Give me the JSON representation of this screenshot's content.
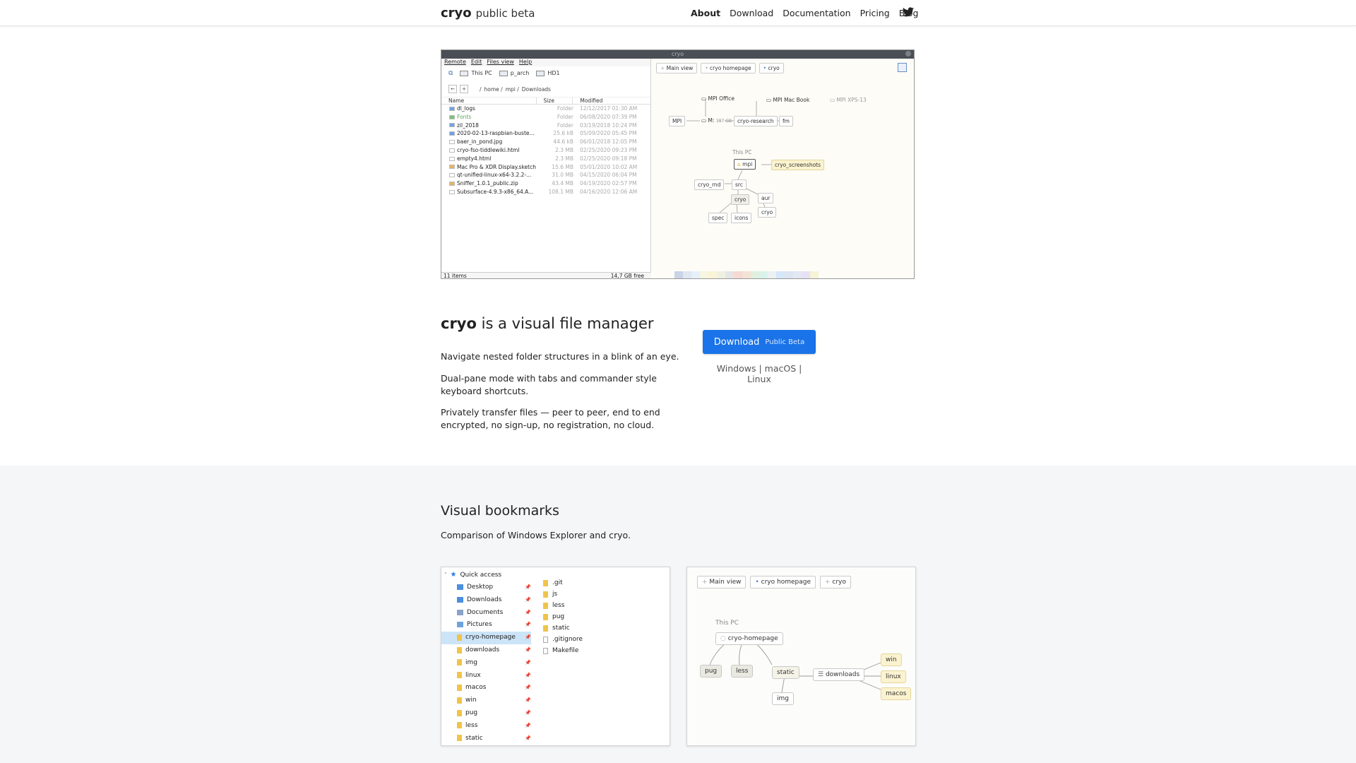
{
  "nav": {
    "brand": "cryo",
    "brand_sub": "public beta",
    "links": [
      "About",
      "Download",
      "Documentation",
      "Pricing",
      "Blog"
    ]
  },
  "hero_shot": {
    "window_title": "cryo",
    "menu": [
      "Remote",
      "Edit",
      "Files view",
      "Help"
    ],
    "drives": [
      "This PC",
      "p_arch",
      "HD1"
    ],
    "path": [
      "/",
      "home /",
      "mpi /",
      "Downloads"
    ],
    "columns": [
      "Name",
      "Size",
      "Modified"
    ],
    "files": [
      {
        "name": "dl_logs",
        "size": "Folder",
        "date": "12/12/2017",
        "time": "01:30 AM",
        "kind": "folder"
      },
      {
        "name": "Fonts",
        "size": "Folder",
        "date": "06/08/2020",
        "time": "07:39 PM",
        "kind": "folder-green"
      },
      {
        "name": "zil_2018",
        "size": "Folder",
        "date": "03/19/2018",
        "time": "10:24 PM",
        "kind": "folder"
      },
      {
        "name": "2020-02-13-raspbian-buste...",
        "size": "25.6 kB",
        "date": "05/09/2020",
        "time": "05:45 PM",
        "kind": "image"
      },
      {
        "name": "baer_in_pond.jpg",
        "size": "44.6 kB",
        "date": "06/01/2018",
        "time": "12:05 PM",
        "kind": "plain"
      },
      {
        "name": "cryo-fso-tiddlewiki.html",
        "size": "2.3 MB",
        "date": "02/25/2020",
        "time": "09:23 PM",
        "kind": "link"
      },
      {
        "name": "empty4.html",
        "size": "2.3 MB",
        "date": "02/25/2020",
        "time": "09:18 PM",
        "kind": "link"
      },
      {
        "name": "Mac Pro & XDR Display.sketch",
        "size": "15.6 MB",
        "date": "05/01/2020",
        "time": "10:02 AM",
        "kind": "sketch"
      },
      {
        "name": "qt-unified-linux-x64-3.2.2-...",
        "size": "31.0 MB",
        "date": "04/15/2020",
        "time": "06:04 PM",
        "kind": "plain"
      },
      {
        "name": "Sniffer_1.0.1_public.zip",
        "size": "43.4 MB",
        "date": "04/19/2020",
        "time": "02:57 PM",
        "kind": "sketch"
      },
      {
        "name": "Subsurface-4.9.3-x86_64.A...",
        "size": "108.1 MB",
        "date": "04/16/2020",
        "time": "12:06 AM",
        "kind": "plain"
      }
    ],
    "status_left": "11 items",
    "status_right": "14,7 GB free",
    "tabs": [
      "Main view",
      "cryo homepage",
      "cryo"
    ],
    "graph": {
      "mpi_office": "MPI Office",
      "mpi_macbook": "MPI Mac Book",
      "mpi_xps": "MPI XPS-13",
      "mpi": "MPI",
      "m_drive": "M:",
      "m_size": "387 GB",
      "cryo_research": "cryo-research",
      "fm": "fm",
      "this_pc": "This PC",
      "mpi_home": "mpi",
      "cryo_screenshots": "cryo_screenshots",
      "cryo_rnd": "cryo_rnd",
      "src": "src",
      "aur": "aur",
      "cryo1": "cryo",
      "cryo2": "cryo",
      "spec": "spec",
      "icons": "icons"
    },
    "strip_colors": [
      "#c9d4e6",
      "#dfe7f1",
      "#e6f0fb",
      "#f6f6e1",
      "#f9f4d8",
      "#eef0e1",
      "#e5e5e5",
      "#f6d8d4",
      "#f3e3d6",
      "#e1efde",
      "#d9f3ec",
      "#ecf1f3",
      "#d5e7f8",
      "#dde4f2",
      "#e3e8f2",
      "#e8e1f6",
      "#f6f3d6"
    ]
  },
  "intro": {
    "title_bold": "cryo",
    "title_rest": "is a visual file manager",
    "features": [
      "Navigate nested folder structures in a blink of an eye.",
      "Dual-pane mode with tabs and commander style keyboard shortcuts.",
      "Privately transfer files — peer to peer, end to end encrypted, no sign-up, no registration, no cloud."
    ],
    "download_label": "Download",
    "download_badge": "Public Beta",
    "platforms": "Windows | macOS | Linux"
  },
  "bookmarks": {
    "title": "Visual bookmarks",
    "subtitle": "Comparison of Windows Explorer and cryo.",
    "explorer": {
      "quick_access": "Quick access",
      "items": [
        "Desktop",
        "Downloads",
        "Documents",
        "Pictures",
        "cryo-homepage",
        "downloads",
        "img",
        "linux",
        "macos",
        "win",
        "pug",
        "less",
        "static"
      ],
      "right_files": [
        ".git",
        "js",
        "less",
        "pug",
        "static",
        ".gitignore",
        "Makefile"
      ]
    },
    "cryo": {
      "tabs": [
        "Main view",
        "cryo homepage",
        "cryo"
      ],
      "this_pc": "This PC",
      "root": "cryo-homepage",
      "pug": "pug",
      "less": "less",
      "static": "static",
      "img": "img",
      "downloads": "downloads",
      "win": "win",
      "linux": "linux",
      "macos": "macos"
    }
  },
  "colors": {
    "accent": "#1a73e8",
    "section_bg": "#f5f6f8",
    "yellow_node": "#fbf3cf"
  }
}
